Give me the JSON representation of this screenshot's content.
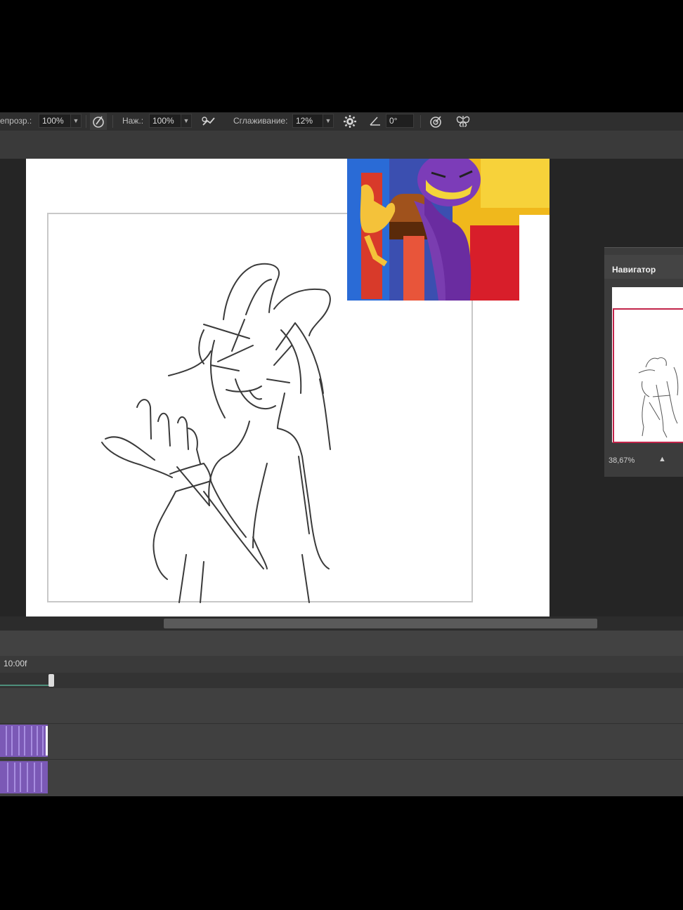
{
  "options_bar": {
    "opacity_label": "епрозр.:",
    "opacity_value": "100%",
    "flow_label": "Наж.:",
    "flow_value": "100%",
    "smoothing_label": "Сглаживание:",
    "smoothing_value": "12%",
    "angle_value": "0°"
  },
  "navigator": {
    "title": "Навигатор",
    "zoom": "38,67%"
  },
  "timeline": {
    "time_label": "10:00f"
  },
  "colors": {
    "accent_nav": "#c2244a",
    "clip_purple": "#7b59b6",
    "panel_bg": "#3c3c3c"
  },
  "icons": [
    "brush-pressure-icon",
    "airbrush-icon",
    "gear-icon",
    "angle-icon",
    "pressure-size-icon",
    "symmetry-icon"
  ]
}
